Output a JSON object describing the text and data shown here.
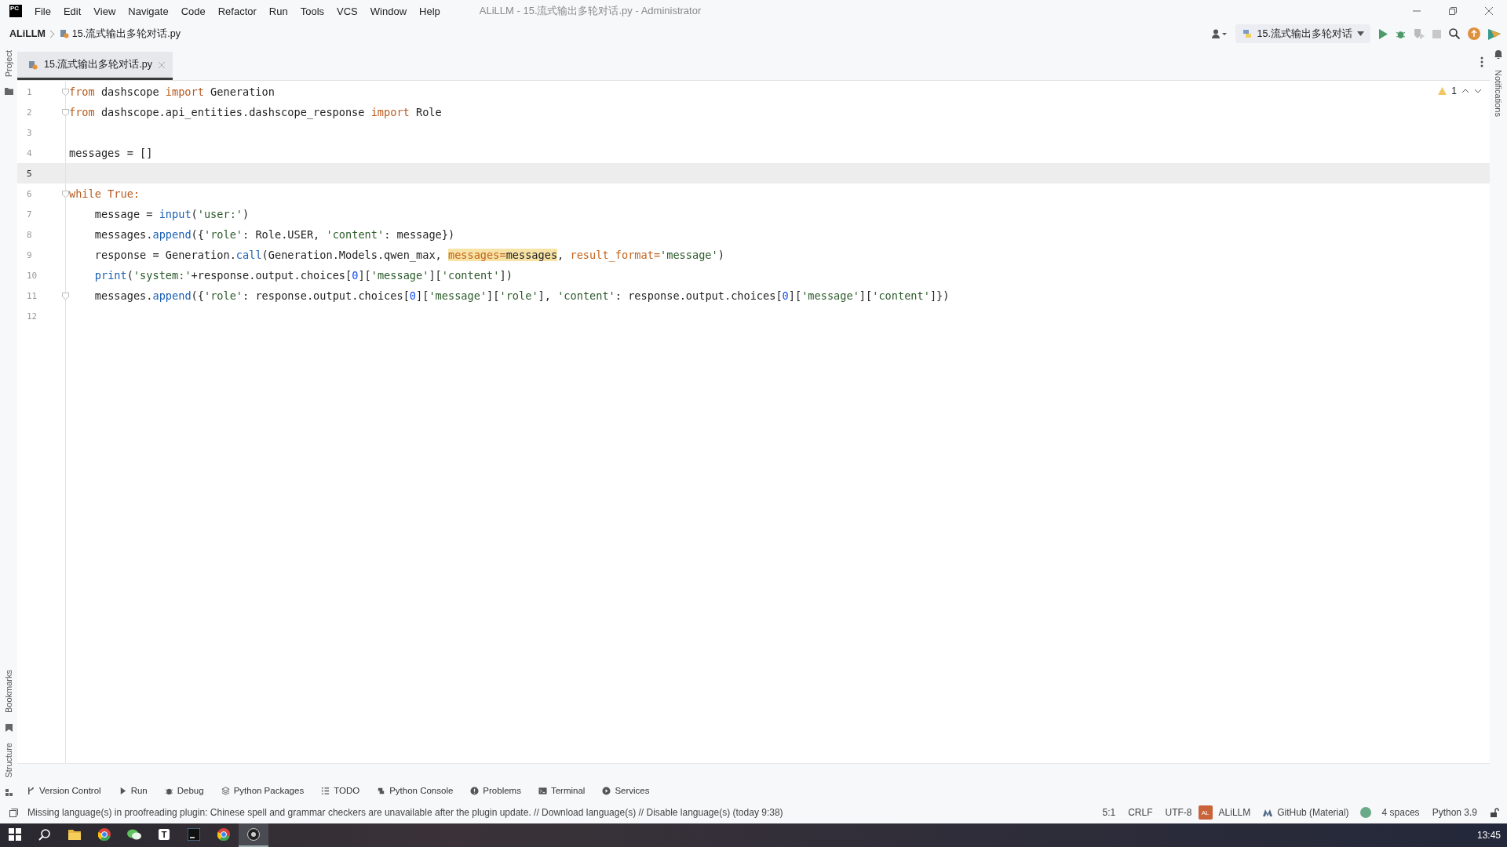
{
  "menu_bar": {
    "app_icon": "PC",
    "items": [
      "File",
      "Edit",
      "View",
      "Navigate",
      "Code",
      "Refactor",
      "Run",
      "Tools",
      "VCS",
      "Window",
      "Help"
    ],
    "title": "ALiLLM - 15.流式输出多轮对话.py - Administrator"
  },
  "nav_bar": {
    "project": "ALiLLM",
    "file": "15.流式输出多轮对话.py",
    "run_config": "15.流式输出多轮对话"
  },
  "left_strip": {
    "top": [
      "Project"
    ],
    "bottom": [
      "Bookmarks",
      "Structure"
    ]
  },
  "right_strip": [
    "Notifications"
  ],
  "tabs": [
    {
      "label": "15.流式输出多轮对话.py",
      "selected": true
    }
  ],
  "inspection": {
    "warnings": "1"
  },
  "editor": {
    "lines": [
      {
        "number": "1",
        "current": false,
        "fold": true,
        "tokens": [
          {
            "kind": "kw",
            "text": "from"
          },
          {
            "kind": "plain",
            "text": " dashscope "
          },
          {
            "kind": "kw",
            "text": "import"
          },
          {
            "kind": "plain",
            "text": " Generation"
          }
        ]
      },
      {
        "number": "2",
        "current": false,
        "fold": true,
        "tokens": [
          {
            "kind": "kw",
            "text": "from"
          },
          {
            "kind": "plain",
            "text": " dashscope.api_entities.dashscope_response "
          },
          {
            "kind": "kw",
            "text": "import"
          },
          {
            "kind": "plain",
            "text": " Role"
          }
        ]
      },
      {
        "number": "3",
        "current": false,
        "fold": false
      },
      {
        "number": "4",
        "current": false,
        "fold": false,
        "tokens": [
          {
            "kind": "plain",
            "text": "messages = []"
          }
        ]
      },
      {
        "number": "5",
        "current": true,
        "fold": false
      },
      {
        "number": "6",
        "current": false,
        "fold": true,
        "tokens": [
          {
            "kind": "kw",
            "text": "while True:"
          }
        ]
      },
      {
        "number": "7",
        "current": false,
        "fold": false,
        "indented": true,
        "tokens": [
          {
            "kind": "plain",
            "text": "message = "
          },
          {
            "kind": "func",
            "text": "input"
          },
          {
            "kind": "plain",
            "text": "("
          },
          {
            "kind": "str",
            "text": "'user:'"
          },
          {
            "kind": "plain",
            "text": ")"
          }
        ]
      },
      {
        "number": "8",
        "current": false,
        "fold": false,
        "indented": true,
        "tokens": [
          {
            "kind": "plain",
            "text": "messages."
          },
          {
            "kind": "func",
            "text": "append"
          },
          {
            "kind": "plain",
            "text": "({"
          },
          {
            "kind": "str",
            "text": "'role'"
          },
          {
            "kind": "plain",
            "text": ": Role.USER, "
          },
          {
            "kind": "str",
            "text": "'content'"
          },
          {
            "kind": "plain",
            "text": ": message})"
          }
        ]
      },
      {
        "number": "9",
        "current": false,
        "fold": false,
        "indented": true,
        "tokens": [
          {
            "kind": "plain",
            "text": "response = Generation."
          },
          {
            "kind": "func",
            "text": "call"
          },
          {
            "kind": "plain",
            "text": "(Generation.Models.qwen_max, "
          },
          {
            "kind": "hl-param",
            "text": "messages="
          },
          {
            "kind": "hl-plain",
            "text": "messages"
          },
          {
            "kind": "plain",
            "text": ", "
          },
          {
            "kind": "param",
            "text": "result_format="
          },
          {
            "kind": "str",
            "text": "'message'"
          },
          {
            "kind": "plain",
            "text": ")"
          }
        ]
      },
      {
        "number": "10",
        "current": false,
        "fold": false,
        "indented": true,
        "tokens": [
          {
            "kind": "func",
            "text": "print"
          },
          {
            "kind": "plain",
            "text": "("
          },
          {
            "kind": "str",
            "text": "'system:'"
          },
          {
            "kind": "plain",
            "text": "+response.output.choices["
          },
          {
            "kind": "num",
            "text": "0"
          },
          {
            "kind": "plain",
            "text": "]["
          },
          {
            "kind": "str",
            "text": "'message'"
          },
          {
            "kind": "plain",
            "text": "]["
          },
          {
            "kind": "str",
            "text": "'content'"
          },
          {
            "kind": "plain",
            "text": "])"
          }
        ]
      },
      {
        "number": "11",
        "current": false,
        "fold": true,
        "indented": true,
        "tokens": [
          {
            "kind": "plain",
            "text": "messages."
          },
          {
            "kind": "func",
            "text": "append"
          },
          {
            "kind": "plain",
            "text": "({"
          },
          {
            "kind": "str",
            "text": "'role'"
          },
          {
            "kind": "plain",
            "text": ": response.output.choices["
          },
          {
            "kind": "num",
            "text": "0"
          },
          {
            "kind": "plain",
            "text": "]["
          },
          {
            "kind": "str",
            "text": "'message'"
          },
          {
            "kind": "plain",
            "text": "]["
          },
          {
            "kind": "str",
            "text": "'role'"
          },
          {
            "kind": "plain",
            "text": "], "
          },
          {
            "kind": "str",
            "text": "'content'"
          },
          {
            "kind": "plain",
            "text": ": response.output.choices["
          },
          {
            "kind": "num",
            "text": "0"
          },
          {
            "kind": "plain",
            "text": "]["
          },
          {
            "kind": "str",
            "text": "'message'"
          },
          {
            "kind": "plain",
            "text": "]["
          },
          {
            "kind": "str",
            "text": "'content'"
          },
          {
            "kind": "plain",
            "text": "]})"
          }
        ]
      },
      {
        "number": "12",
        "current": false,
        "fold": false
      }
    ]
  },
  "tool_windows": [
    {
      "kind": "vcs",
      "label": "Version Control"
    },
    {
      "kind": "run",
      "label": "Run"
    },
    {
      "kind": "debug",
      "label": "Debug"
    },
    {
      "kind": "packages",
      "label": "Python Packages"
    },
    {
      "kind": "todo",
      "label": "TODO"
    },
    {
      "kind": "console",
      "label": "Python Console"
    },
    {
      "kind": "problems",
      "label": "Problems"
    },
    {
      "kind": "terminal",
      "label": "Terminal"
    },
    {
      "kind": "services",
      "label": "Services"
    }
  ],
  "status_bar": {
    "message": "Missing language(s) in proofreading plugin: Chinese spell and grammar checkers are unavailable after the plugin update. // Download language(s) // Disable language(s) (today 9:38)",
    "items": [
      {
        "kind": "text",
        "label": "5:1"
      },
      {
        "kind": "text",
        "label": "CRLF"
      },
      {
        "kind": "text",
        "label": "UTF-8"
      },
      {
        "kind": "project",
        "badge": "AL",
        "label": "ALiLLM"
      },
      {
        "kind": "theme",
        "label": "GitHub (Material)"
      },
      {
        "kind": "dot"
      },
      {
        "kind": "text",
        "label": "4 spaces"
      },
      {
        "kind": "text",
        "label": "Python 3.9"
      },
      {
        "kind": "lock"
      }
    ]
  },
  "taskbar": {
    "apps": [
      {
        "kind": "start",
        "selected": false
      },
      {
        "kind": "search",
        "selected": false
      },
      {
        "kind": "folder",
        "selected": false
      },
      {
        "kind": "browser",
        "selected": false
      },
      {
        "kind": "chat",
        "selected": false
      },
      {
        "kind": "letter",
        "text": "T",
        "selected": false
      },
      {
        "kind": "ide",
        "selected": false
      },
      {
        "kind": "browser",
        "selected": false
      },
      {
        "kind": "recorder",
        "selected": true
      }
    ],
    "clock": "13:45"
  }
}
